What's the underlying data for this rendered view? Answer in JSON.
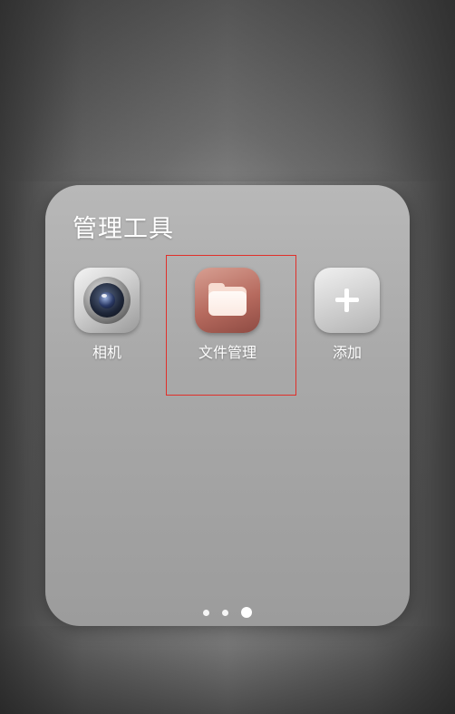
{
  "folder": {
    "title": "管理工具",
    "apps": [
      {
        "label": "相机",
        "icon": "camera-icon"
      },
      {
        "label": "文件管理",
        "icon": "folder-icon",
        "highlighted": true
      },
      {
        "label": "添加",
        "icon": "plus-icon"
      }
    ],
    "pagination": {
      "total": 3,
      "current": 3
    }
  },
  "colors": {
    "highlight_border": "#e0302a",
    "files_icon_bg": "#b66a5e",
    "label_text": "#ffffff"
  }
}
